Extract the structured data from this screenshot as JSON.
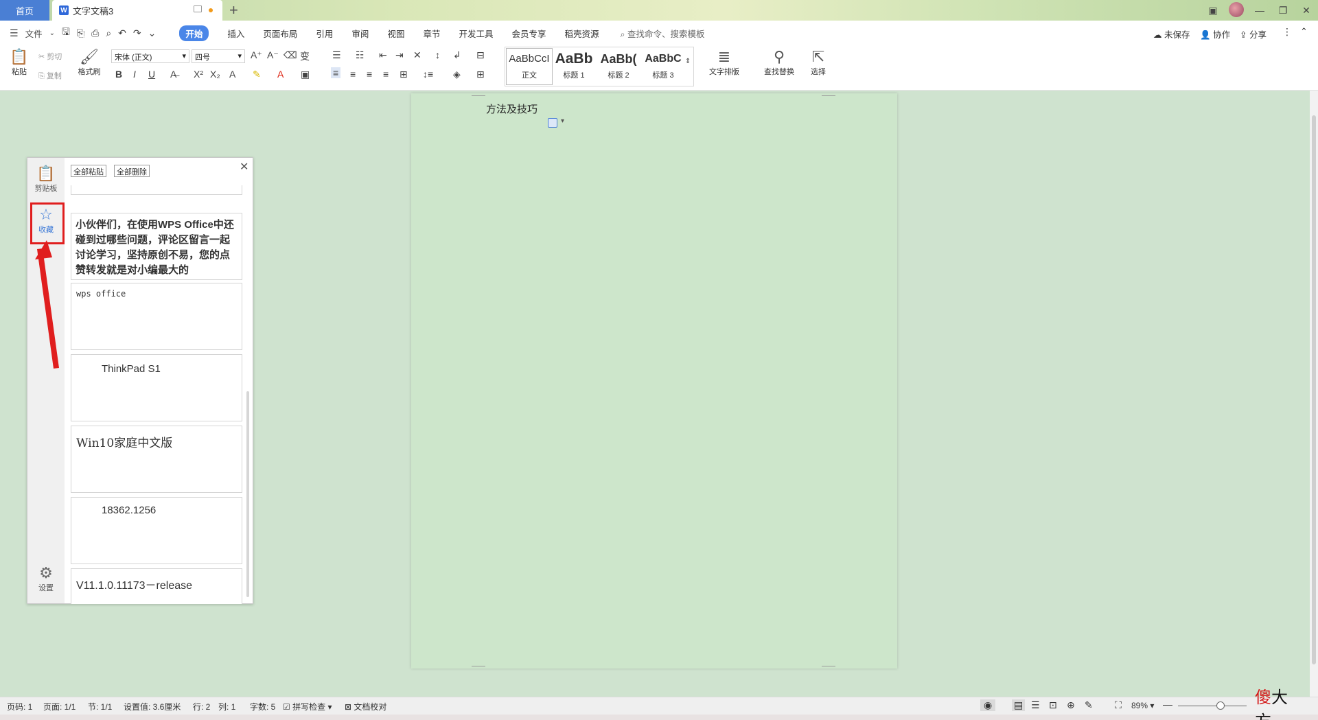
{
  "titlebar": {
    "home_tab": "首页",
    "doc_tab": "文字文稿3",
    "doc_icon": "W",
    "new_tab": "+"
  },
  "menubar": {
    "file": "文件",
    "items": [
      "开始",
      "插入",
      "页面布局",
      "引用",
      "审阅",
      "视图",
      "章节",
      "开发工具",
      "会员专享",
      "稻壳资源"
    ],
    "active": "开始",
    "search": "查找命令、搜索模板",
    "unsaved": "未保存",
    "collab": "协作",
    "share": "分享"
  },
  "ribbon": {
    "paste": "粘贴",
    "cut": "剪切",
    "copy": "复制",
    "format_painter": "格式刷",
    "font_name": "宋体 (正文)",
    "font_size": "四号",
    "styles": [
      {
        "sample": "AaBbCcI",
        "name": "正文"
      },
      {
        "sample": "AaBb",
        "name": "标题 1"
      },
      {
        "sample": "AaBb(",
        "name": "标题 2"
      },
      {
        "sample": "AaBbC",
        "name": "标题 3"
      }
    ],
    "text_layout": "文字排版",
    "find_replace": "查找替换",
    "select": "选择"
  },
  "document": {
    "text": "方法及技巧"
  },
  "clipboard": {
    "paste_all": "全部粘贴",
    "delete_all": "全部删除",
    "side_clipboard": "剪贴板",
    "side_favorites": "收藏",
    "side_settings": "设置",
    "items": [
      "小伙伴们，在使用WPS Office中还碰到过哪些问题，评论区留言一起讨论学习，坚持原创不易，您的点赞转发就是对小编最大的",
      "wps office",
      "ThinkPad S1",
      "Win10家庭中文版",
      "18362.1256",
      "V11.1.0.11173－release"
    ]
  },
  "status": {
    "page_code": "页码: 1",
    "pages": "页面: 1/1",
    "section": "节: 1/1",
    "setting": "设置值: 3.6厘米",
    "row": "行: 2",
    "col": "列: 1",
    "words": "字数: 5",
    "spell": "拼写检查",
    "proof": "文档校对",
    "zoom": "89%"
  },
  "watermark": {
    "red": "傻",
    "rest": "大方。"
  },
  "colors": {
    "accent": "#4a86e8",
    "highlight": "#e01e1e",
    "page": "#cde6cb"
  }
}
